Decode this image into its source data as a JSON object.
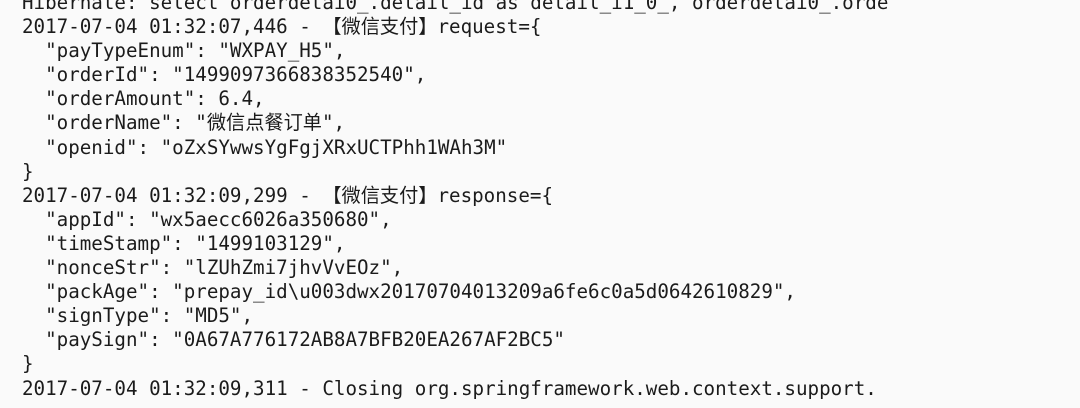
{
  "console": {
    "lines": [
      "Hibernate: select orderdetai0_.detail_id as detail_i1_0_, orderdetai0_.orde",
      "2017-07-04 01:32:07,446 - 【微信支付】request={",
      "  \"payTypeEnum\": \"WXPAY_H5\",",
      "  \"orderId\": \"1499097366838352540\",",
      "  \"orderAmount\": 6.4,",
      "  \"orderName\": \"微信点餐订单\",",
      "  \"openid\": \"oZxSYwwsYgFgjXRxUCTPhh1WAh3M\"",
      "}",
      "2017-07-04 01:32:09,299 - 【微信支付】response={",
      "  \"appId\": \"wx5aecc6026a350680\",",
      "  \"timeStamp\": \"1499103129\",",
      "  \"nonceStr\": \"lZUhZmi7jhvVvEOz\",",
      "  \"packAge\": \"prepay_id\\u003dwx20170704013209a6fe6c0a5d0642610829\",",
      "  \"signType\": \"MD5\",",
      "  \"paySign\": \"0A67A776172AB8A7BFB20EA267AF2BC5\"",
      "}",
      "2017-07-04 01:32:09,311 - Closing org.springframework.web.context.support."
    ]
  }
}
